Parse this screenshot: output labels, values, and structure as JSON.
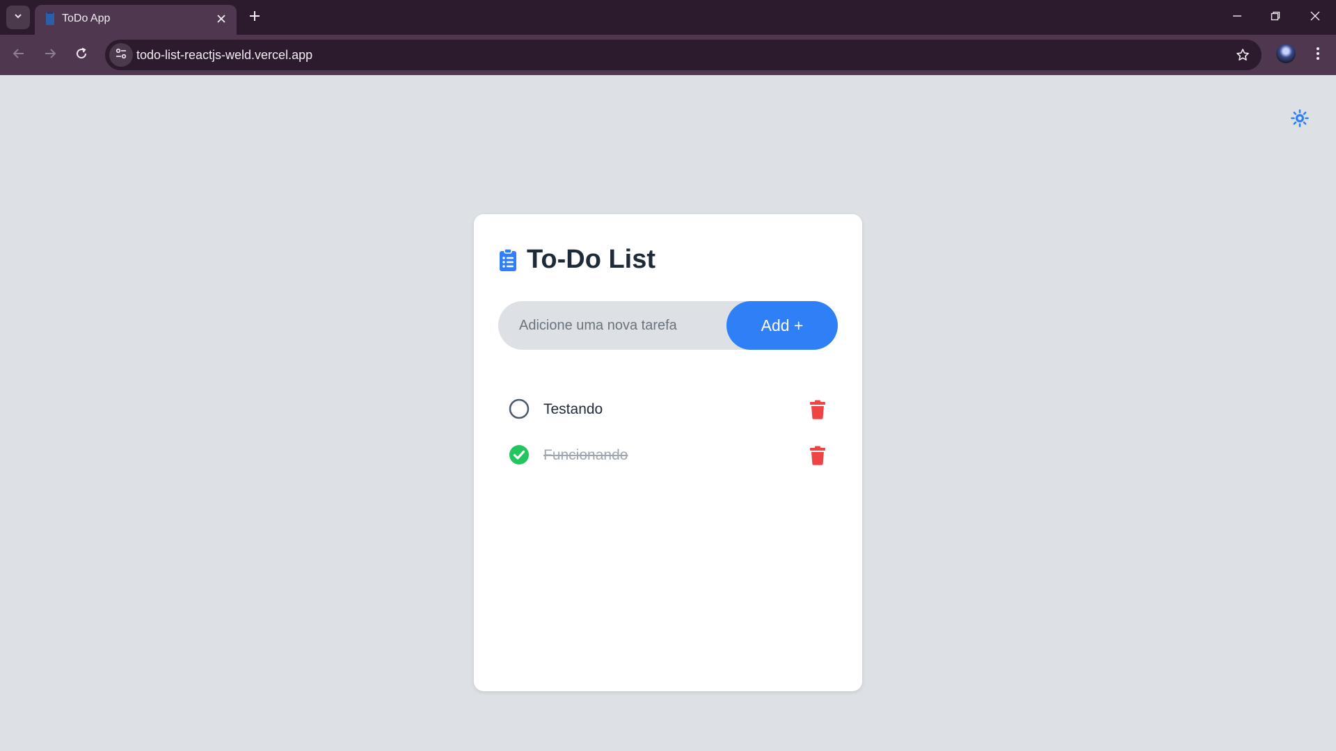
{
  "browser": {
    "tab_title": "ToDo App",
    "url": "todo-list-reactjs-weld.vercel.app"
  },
  "app": {
    "title": "To-Do List",
    "input_placeholder": "Adicione uma nova tarefa",
    "input_value": "",
    "add_button_label": "Add +",
    "tasks": [
      {
        "text": "Testando",
        "completed": false
      },
      {
        "text": "Funcionando",
        "completed": true
      }
    ]
  },
  "icons": {
    "theme_toggle": "sun-icon",
    "heading": "clipboard-list-icon",
    "delete": "trash-icon",
    "unchecked": "circle-icon",
    "checked": "check-circle-icon"
  },
  "colors": {
    "accent": "#2f80f7",
    "success": "#22c55e",
    "danger": "#ef4444",
    "page_background": "#dde1e5"
  }
}
